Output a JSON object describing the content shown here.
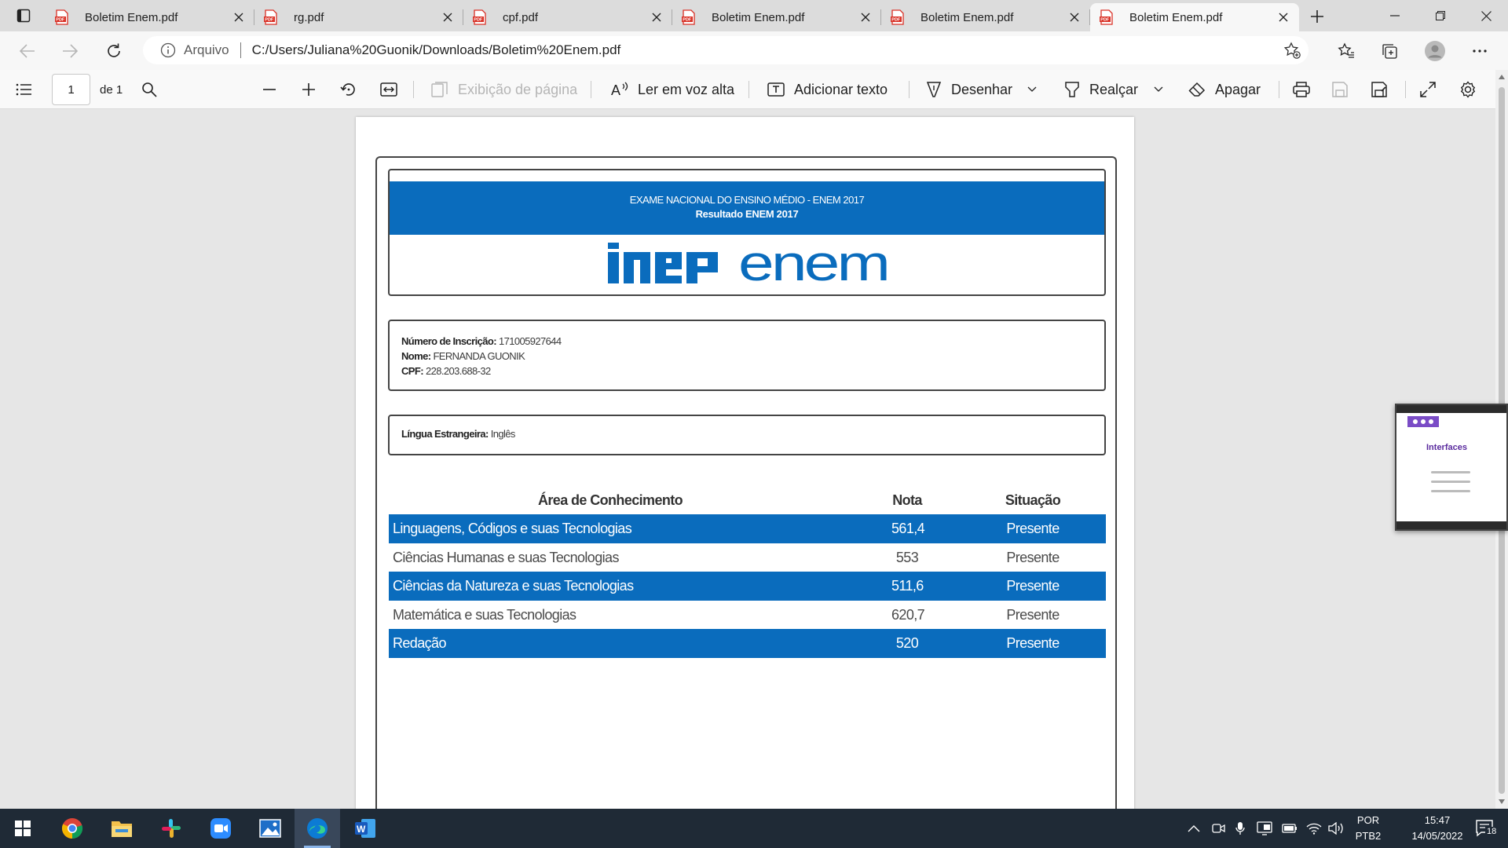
{
  "tabs": [
    {
      "title": "Boletim Enem.pdf",
      "active": false
    },
    {
      "title": "rg.pdf",
      "active": false
    },
    {
      "title": "cpf.pdf",
      "active": false
    },
    {
      "title": "Boletim Enem.pdf",
      "active": false
    },
    {
      "title": "Boletim Enem.pdf",
      "active": false
    },
    {
      "title": "Boletim Enem.pdf",
      "active": true
    }
  ],
  "address": {
    "origin": "Arquivo",
    "url": "C:/Users/Juliana%20Guonik/Downloads/Boletim%20Enem.pdf"
  },
  "pdf_toolbar": {
    "page_number": "1",
    "page_of": "de 1",
    "page_view": "Exibição de página",
    "read_aloud": "Ler em voz alta",
    "add_text": "Adicionar texto",
    "draw": "Desenhar",
    "highlight": "Realçar",
    "erase": "Apagar"
  },
  "document": {
    "header_line1": "EXAME NACIONAL DO ENSINO MÉDIO - ENEM 2017",
    "header_line2": "Resultado ENEM 2017",
    "logo_left": "inep",
    "logo_right": "enem",
    "inscricao_label": "Número de Inscrição:",
    "inscricao_value": "171005927644",
    "nome_label": "Nome:",
    "nome_value": "FERNANDA GUONIK",
    "cpf_label": "CPF:",
    "cpf_value": "228.203.688-32",
    "lingua_label": "Língua Estrangeira:",
    "lingua_value": "Inglês",
    "results_headers": {
      "area": "Área de Conhecimento",
      "nota": "Nota",
      "situacao": "Situação"
    },
    "results": [
      {
        "area": "Linguagens, Códigos e suas Tecnologias",
        "nota": "561,4",
        "situacao": "Presente"
      },
      {
        "area": "Ciências Humanas e suas Tecnologias",
        "nota": "553",
        "situacao": "Presente"
      },
      {
        "area": "Ciências da Natureza e suas Tecnologias",
        "nota": "511,6",
        "situacao": "Presente"
      },
      {
        "area": "Matemática e suas Tecnologias",
        "nota": "620,7",
        "situacao": "Presente"
      },
      {
        "area": "Redação",
        "nota": "520",
        "situacao": "Presente"
      }
    ]
  },
  "floating_window": {
    "title": "Interfaces"
  },
  "taskbar": {
    "language_top": "POR",
    "language_bottom": "PTB2",
    "time": "15:47",
    "date": "14/05/2022",
    "notifications": "18"
  },
  "colors": {
    "enem_blue": "#0a6cbd",
    "taskbar": "#1f2a36",
    "pdf_red": "#d93025"
  }
}
